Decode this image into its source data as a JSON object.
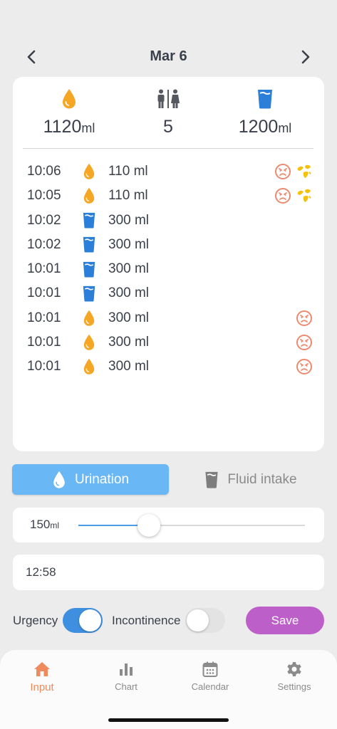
{
  "header": {
    "date": "Mar 6",
    "prev_icon": "chevron-left-icon",
    "next_icon": "chevron-right-icon"
  },
  "summary": {
    "urination_total": {
      "icon": "drop-icon",
      "value": "1120",
      "unit": "ml"
    },
    "visits": {
      "icon": "restroom-icon",
      "value": "5"
    },
    "intake_total": {
      "icon": "cup-icon",
      "value": "1200",
      "unit": "ml"
    }
  },
  "log": [
    {
      "time": "10:06",
      "type": "urination",
      "amount": "110 ml",
      "urgency": true,
      "incontinence": true
    },
    {
      "time": "10:05",
      "type": "urination",
      "amount": "110 ml",
      "urgency": true,
      "incontinence": true
    },
    {
      "time": "10:02",
      "type": "intake",
      "amount": "300 ml",
      "urgency": false,
      "incontinence": false
    },
    {
      "time": "10:02",
      "type": "intake",
      "amount": "300 ml",
      "urgency": false,
      "incontinence": false
    },
    {
      "time": "10:01",
      "type": "intake",
      "amount": "300 ml",
      "urgency": false,
      "incontinence": false
    },
    {
      "time": "10:01",
      "type": "intake",
      "amount": "300 ml",
      "urgency": false,
      "incontinence": false
    },
    {
      "time": "10:01",
      "type": "urination",
      "amount": "300 ml",
      "urgency": true,
      "incontinence": false
    },
    {
      "time": "10:01",
      "type": "urination",
      "amount": "300 ml",
      "urgency": true,
      "incontinence": false
    },
    {
      "time": "10:01",
      "type": "urination",
      "amount": "300 ml",
      "urgency": true,
      "incontinence": false
    }
  ],
  "mode": {
    "urination_label": "Urination",
    "intake_label": "Fluid intake",
    "selected": "urination"
  },
  "volume": {
    "value": "150",
    "unit": "ml",
    "fraction": 0.31
  },
  "time_input": {
    "value": "12:58"
  },
  "toggles": {
    "urgency_label": "Urgency",
    "urgency_on": true,
    "incontinence_label": "Incontinence",
    "incontinence_on": false
  },
  "save_label": "Save",
  "tabs": [
    {
      "label": "Input",
      "icon": "home-icon",
      "active": true
    },
    {
      "label": "Chart",
      "icon": "bar-chart-icon",
      "active": false
    },
    {
      "label": "Calendar",
      "icon": "calendar-icon",
      "active": false
    },
    {
      "label": "Settings",
      "icon": "gear-icon",
      "active": false
    }
  ],
  "colors": {
    "urination": "#f5a623",
    "intake": "#2b7fd8",
    "urgency": "#ec8a6f",
    "incontinence": "#f4c20d",
    "active_tab": "#ee8a5c",
    "save": "#bc5fc9",
    "segment_active": "#6ab7f5"
  }
}
